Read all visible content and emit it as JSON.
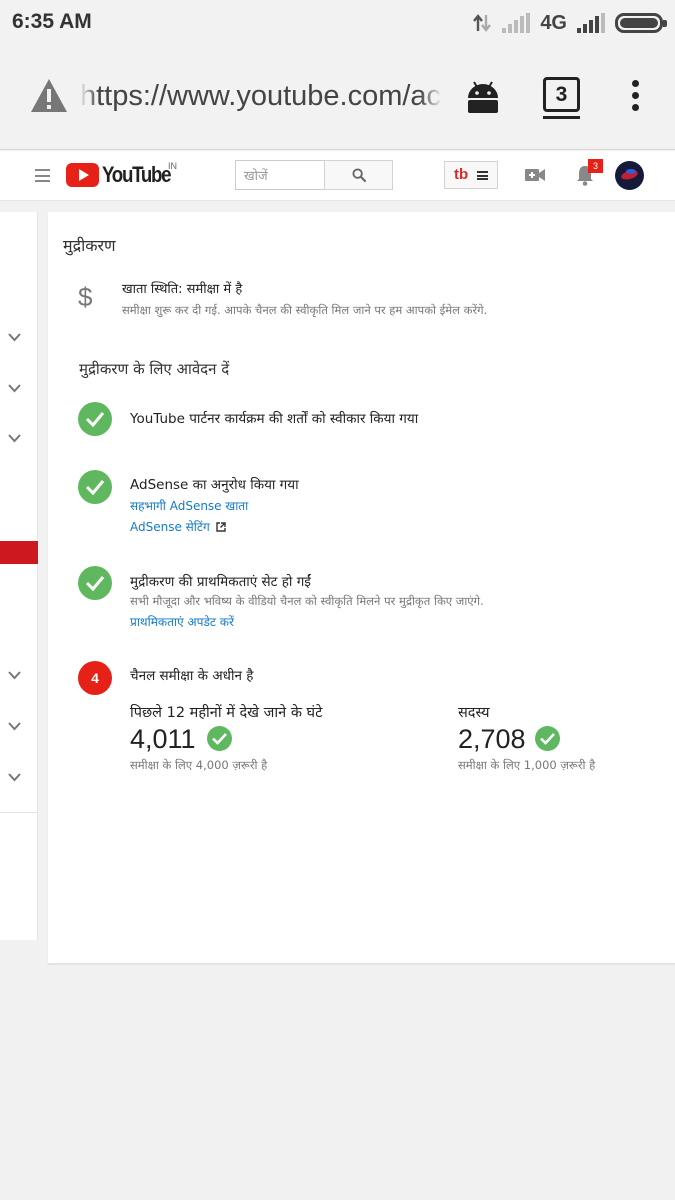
{
  "status_bar": {
    "time": "6:35 AM",
    "network": "4G"
  },
  "browser": {
    "url": "https://www.youtube.com/account_monetization",
    "tab_count": "3"
  },
  "header": {
    "logo_text": "YouTube",
    "country_code": "IN",
    "search_placeholder": "खोजें",
    "tb_label": "tb",
    "notification_count": "3"
  },
  "page": {
    "title": "मुद्रीकरण",
    "account_status": {
      "title": "खाता स्थिति: समीक्षा में है",
      "description": "समीक्षा शुरू कर दी गई. आपके चैनल की स्वीकृति मिल जाने पर हम आपको ईमेल करेंगे."
    },
    "apply_section_title": "मुद्रीकरण के लिए आवेदन दें",
    "steps": [
      {
        "title": "YouTube पार्टनर कार्यक्रम की शर्तों को स्वीकार किया गया"
      },
      {
        "title": "AdSense का अनुरोध किया गया",
        "link1": "सहभागी AdSense खाता",
        "link2": "AdSense सेटिंग"
      },
      {
        "title": "मुद्रीकरण की प्राथमिकताएं सेट हो गईं",
        "description": "सभी मौजूदा और भविष्य के वीडियो चैनल को स्वीकृति मिलने पर मुद्रीकृत किए जाएंगे.",
        "link": "प्राथमिकताएं अपडेट करें"
      },
      {
        "number": "4",
        "title": "चैनल समीक्षा के अधीन है"
      }
    ],
    "metrics": {
      "watch_hours": {
        "label": "पिछले 12 महीनों में देखे जाने के घंटे",
        "value": "4,011",
        "requirement": "समीक्षा के लिए 4,000 ज़रूरी है"
      },
      "subscribers": {
        "label": "सदस्य",
        "value": "2,708",
        "requirement": "समीक्षा के लिए 1,000 ज़रूरी है"
      }
    }
  },
  "colors": {
    "brand_red": "#e62117",
    "success_green": "#5fb85f",
    "link_blue": "#167ac6"
  }
}
